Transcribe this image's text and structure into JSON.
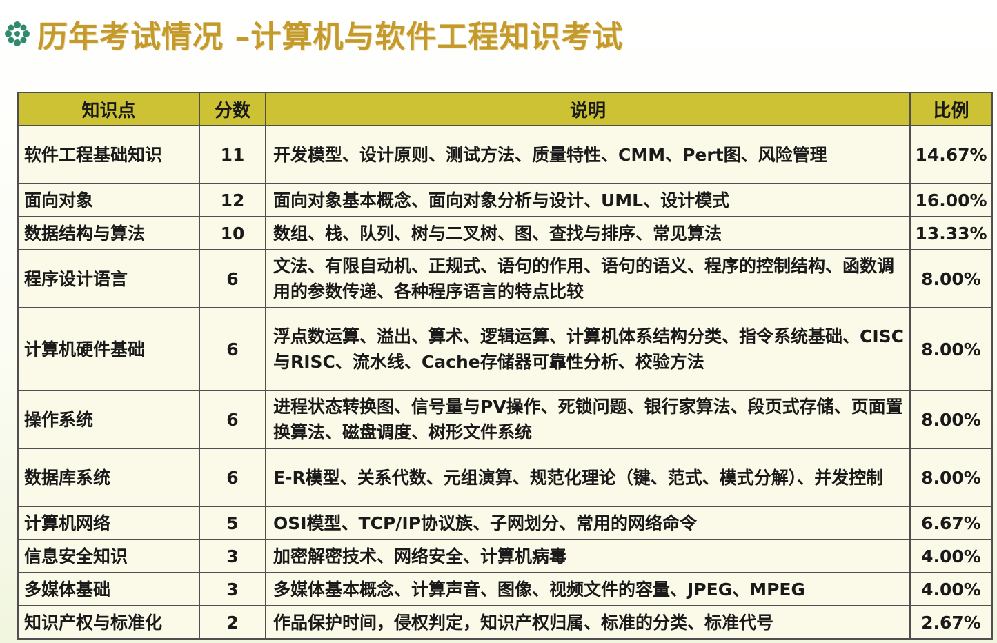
{
  "title": "历年考试情况 –计算机与软件工程知识考试",
  "colors": {
    "title": "#c59a2c",
    "header_bg": "#cdc233",
    "bullet": "#2e8b6e"
  },
  "headers": [
    "知识点",
    "分数",
    "说明",
    "比例"
  ],
  "rows": [
    [
      "软件工程基础知识",
      "11",
      "开发模型、设计原则、测试方法、质量特性、CMM、Pert图、风险管理",
      "14.67%"
    ],
    [
      "面向对象",
      "12",
      "面向对象基本概念、面向对象分析与设计、UML、设计模式",
      "16.00%"
    ],
    [
      "数据结构与算法",
      "10",
      "数组、栈、队列、树与二叉树、图、查找与排序、常见算法",
      "13.33%"
    ],
    [
      "程序设计语言",
      "6",
      "文法、有限自动机、正规式、语句的作用、语句的语义、程序的控制结构、函数调用的参数传递、各种程序语言的特点比较",
      "8.00%"
    ],
    [
      "计算机硬件基础",
      "6",
      "浮点数运算、溢出、算术、逻辑运算、计算机体系结构分类、指令系统基础、CISC与RISC、流水线、Cache存储器可靠性分析、校验方法",
      "8.00%"
    ],
    [
      "操作系统",
      "6",
      "进程状态转换图、信号量与PV操作、死锁问题、银行家算法、段页式存储、页面置换算法、磁盘调度、树形文件系统",
      "8.00%"
    ],
    [
      "数据库系统",
      "6",
      "E-R模型、关系代数、元组演算、规范化理论（键、范式、模式分解）、并发控制",
      "8.00%"
    ],
    [
      "计算机网络",
      "5",
      "OSI模型、TCP/IP协议族、子网划分、常用的网络命令",
      "6.67%"
    ],
    [
      "信息安全知识",
      "3",
      "加密解密技术、网络安全、计算机病毒",
      "4.00%"
    ],
    [
      "多媒体基础",
      "3",
      "多媒体基本概念、计算声音、图像、视频文件的容量、JPEG、MPEG",
      "4.00%"
    ],
    [
      "知识产权与标准化",
      "2",
      "作品保护时间，侵权判定，知识产权归属、标准的分类、标准代号",
      "2.67%"
    ]
  ]
}
